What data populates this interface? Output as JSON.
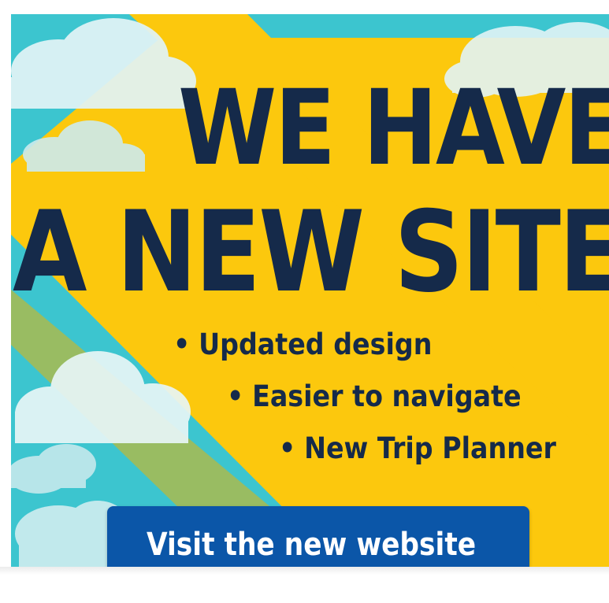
{
  "banner": {
    "headline_line1": "WE HAVE",
    "headline_line2": "A NEW SITE!",
    "bullets": [
      "Updated design",
      "Easier to navigate",
      "New Trip Planner"
    ],
    "cta_label": "Visit the new website",
    "colors": {
      "sky": "#3cc5cf",
      "yellow": "#fcc80d",
      "shadow_yellow": "#e6b40a",
      "navy_text": "#152a4a",
      "cta_blue": "#0b56a8",
      "cloud": "#dff2f4"
    },
    "bullet_icon": "bullet-dot"
  }
}
